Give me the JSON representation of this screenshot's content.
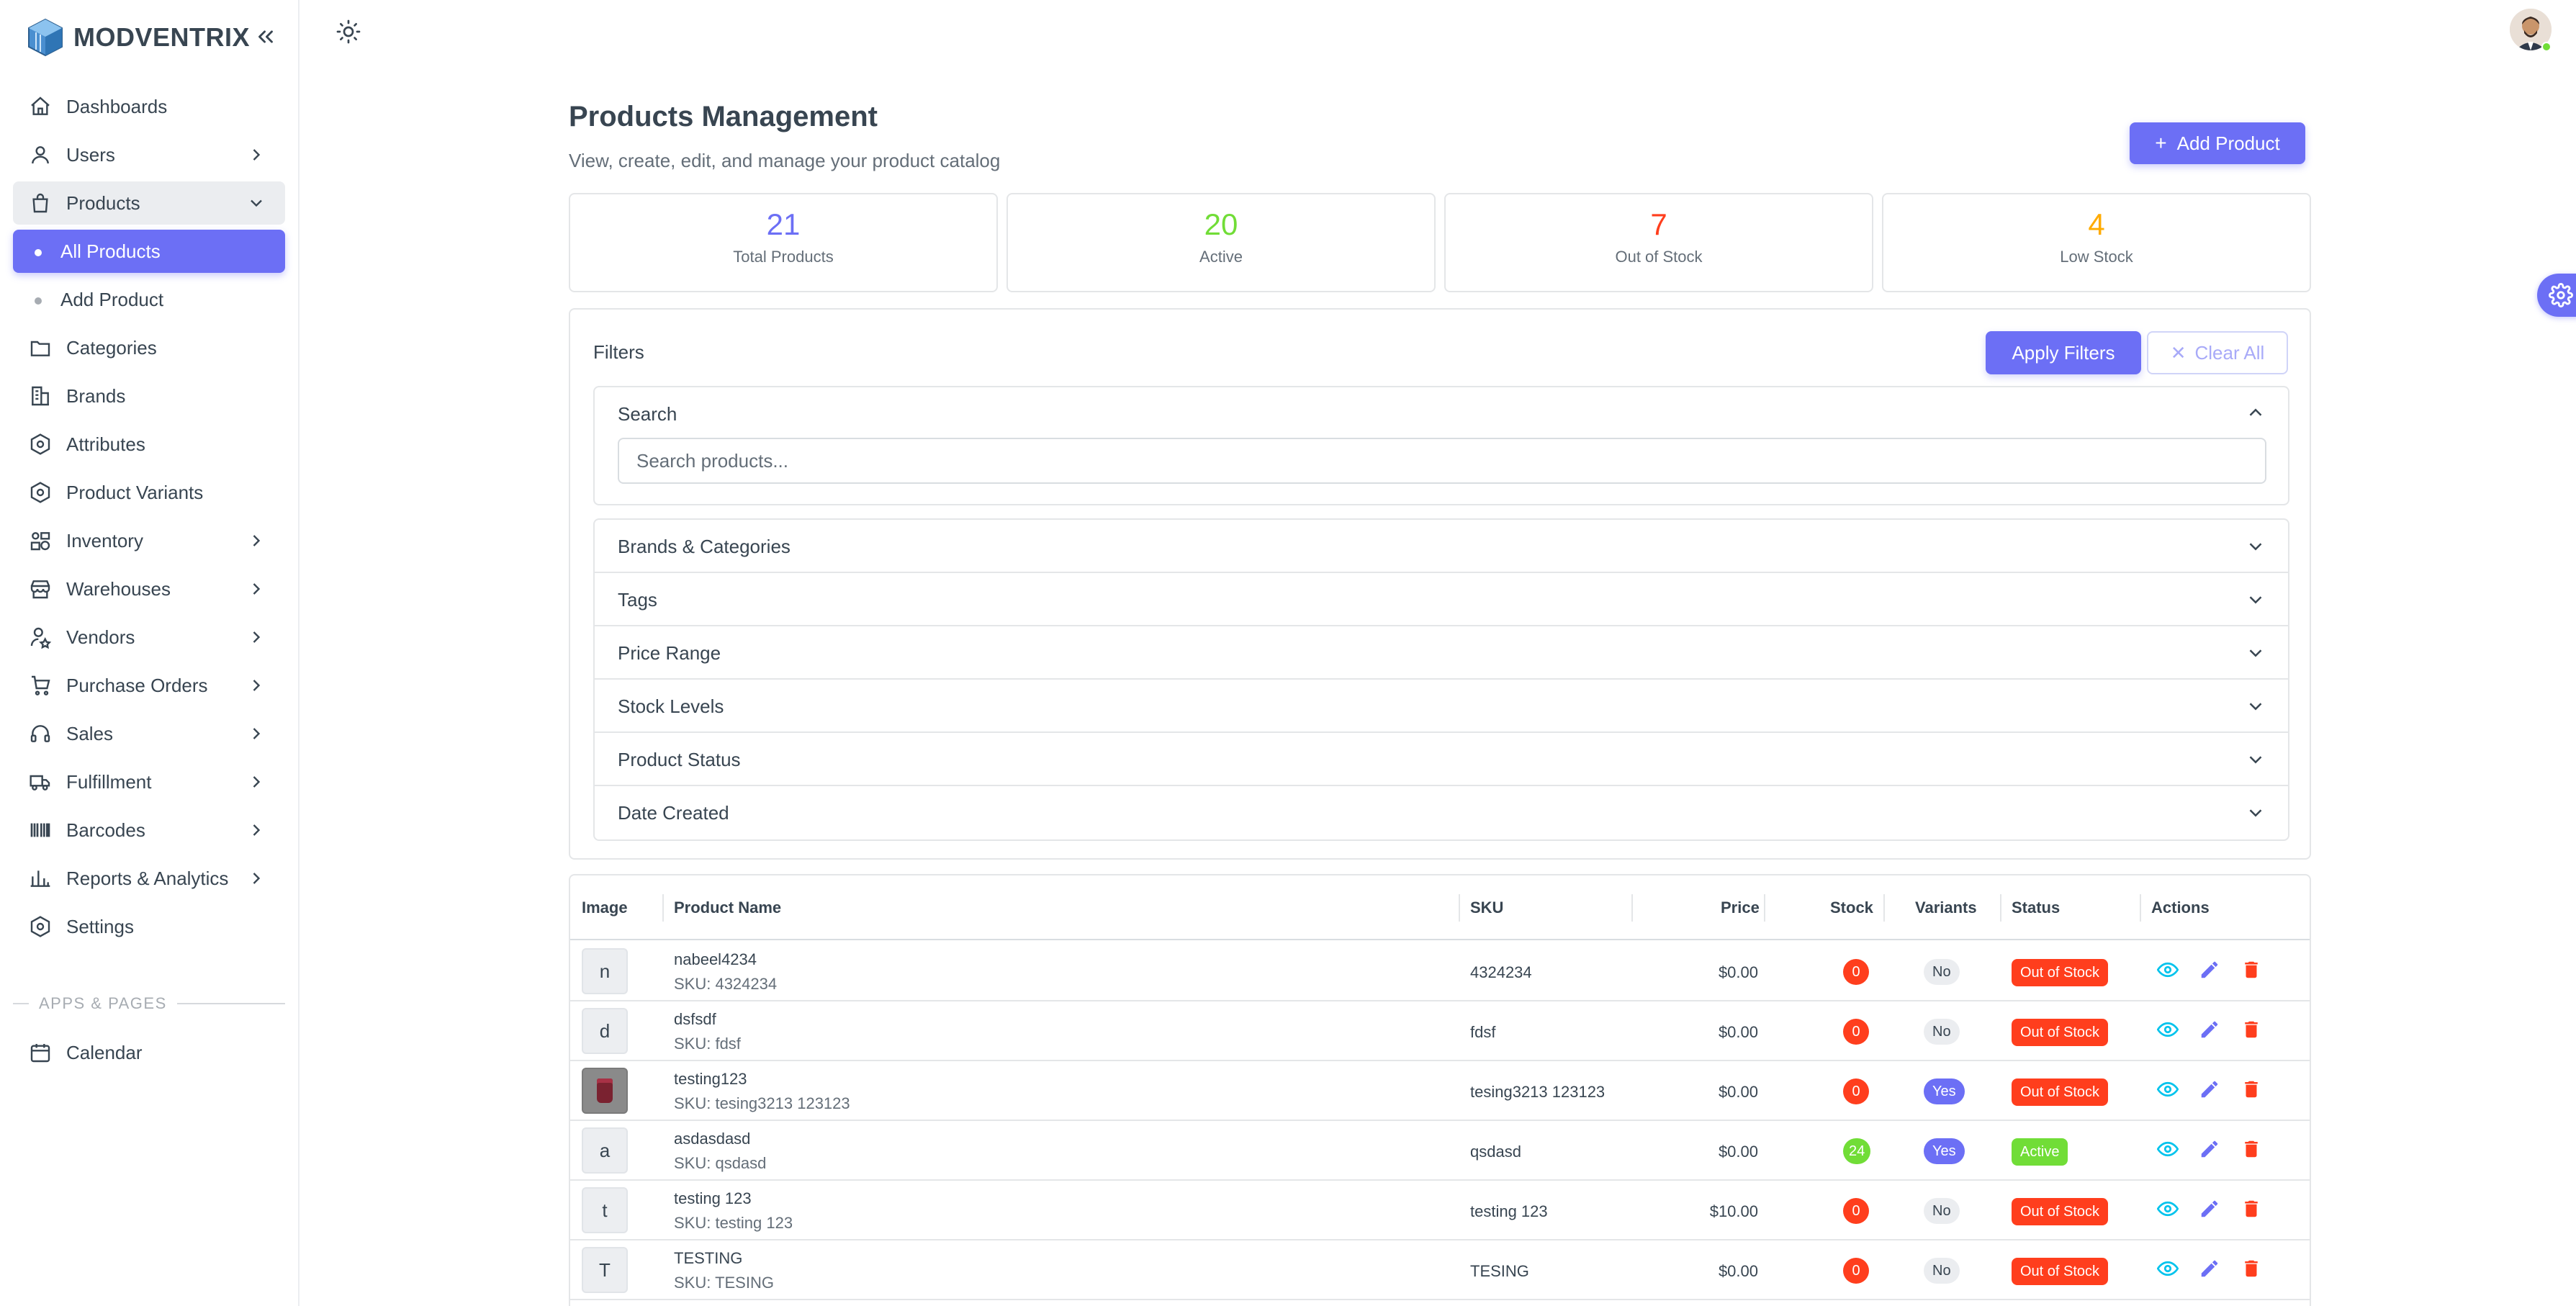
{
  "brand": {
    "name": "MODVENTRIX"
  },
  "sidebar": {
    "items": [
      {
        "label": "Dashboards",
        "icon": "home-icon"
      },
      {
        "label": "Users",
        "icon": "user-icon"
      },
      {
        "label": "Products",
        "icon": "shopping-bag-icon"
      },
      {
        "label": "Categories",
        "icon": "folder-icon"
      },
      {
        "label": "Brands",
        "icon": "building-icon"
      },
      {
        "label": "Attributes",
        "icon": "attribute-icon"
      },
      {
        "label": "Product Variants",
        "icon": "variant-icon"
      },
      {
        "label": "Inventory",
        "icon": "inventory-icon"
      },
      {
        "label": "Warehouses",
        "icon": "warehouse-icon"
      },
      {
        "label": "Vendors",
        "icon": "vendor-icon"
      },
      {
        "label": "Purchase Orders",
        "icon": "cart-icon"
      },
      {
        "label": "Sales",
        "icon": "headset-icon"
      },
      {
        "label": "Fulfillment",
        "icon": "truck-icon"
      },
      {
        "label": "Barcodes",
        "icon": "barcode-icon"
      },
      {
        "label": "Reports & Analytics",
        "icon": "chart-icon"
      },
      {
        "label": "Settings",
        "icon": "settings-icon"
      }
    ],
    "product_sub": [
      {
        "label": "All Products"
      },
      {
        "label": "Add Product"
      }
    ],
    "section_header": "APPS & PAGES",
    "calendar": {
      "label": "Calendar",
      "icon": "calendar-icon"
    }
  },
  "header": {
    "title": "Products Management",
    "subtitle": "View, create, edit, and manage your product catalog",
    "add_button": "Add Product"
  },
  "stats": [
    {
      "value": "21",
      "label": "Total Products",
      "color": "#6c6ff5"
    },
    {
      "value": "20",
      "label": "Active",
      "color": "#71dd37"
    },
    {
      "value": "7",
      "label": "Out of Stock",
      "color": "#ff3e1d"
    },
    {
      "value": "4",
      "label": "Low Stock",
      "color": "#ffab00"
    }
  ],
  "filters": {
    "title": "Filters",
    "apply": "Apply Filters",
    "clear": "Clear All",
    "search_title": "Search",
    "search_placeholder": "Search products...",
    "sections": [
      "Brands & Categories",
      "Tags",
      "Price Range",
      "Stock Levels",
      "Product Status",
      "Date Created"
    ]
  },
  "table": {
    "headers": [
      "Image",
      "Product Name",
      "SKU",
      "Price",
      "Stock",
      "Variants",
      "Status",
      "Actions"
    ],
    "rows": [
      {
        "thumb": "n",
        "name": "nabeel4234",
        "sku_line": "SKU: 4324234",
        "sku": "4324234",
        "price": "$0.00",
        "stock": "0",
        "variants": "No",
        "status": "Out of Stock"
      },
      {
        "thumb": "d",
        "name": "dsfsdf",
        "sku_line": "SKU: fdsf",
        "sku": "fdsf",
        "price": "$0.00",
        "stock": "0",
        "variants": "No",
        "status": "Out of Stock"
      },
      {
        "thumb": "",
        "name": "testing123",
        "sku_line": "SKU: tesing3213 123123",
        "sku": "tesing3213 123123",
        "price": "$0.00",
        "stock": "0",
        "variants": "Yes",
        "status": "Out of Stock"
      },
      {
        "thumb": "a",
        "name": "asdasdasd",
        "sku_line": "SKU: qsdasd",
        "sku": "qsdasd",
        "price": "$0.00",
        "stock": "24",
        "variants": "Yes",
        "status": "Active"
      },
      {
        "thumb": "t",
        "name": "testing 123",
        "sku_line": "SKU: testing 123",
        "sku": "testing 123",
        "price": "$10.00",
        "stock": "0",
        "variants": "No",
        "status": "Out of Stock"
      },
      {
        "thumb": "T",
        "name": "TESTING",
        "sku_line": "SKU: TESING",
        "sku": "TESING",
        "price": "$0.00",
        "stock": "0",
        "variants": "No",
        "status": "Out of Stock"
      }
    ]
  },
  "colors": {
    "primary": "#6c6ff5",
    "danger": "#ff3e1d",
    "success": "#71dd37",
    "warning": "#ffab00",
    "info": "#03c3ec"
  }
}
